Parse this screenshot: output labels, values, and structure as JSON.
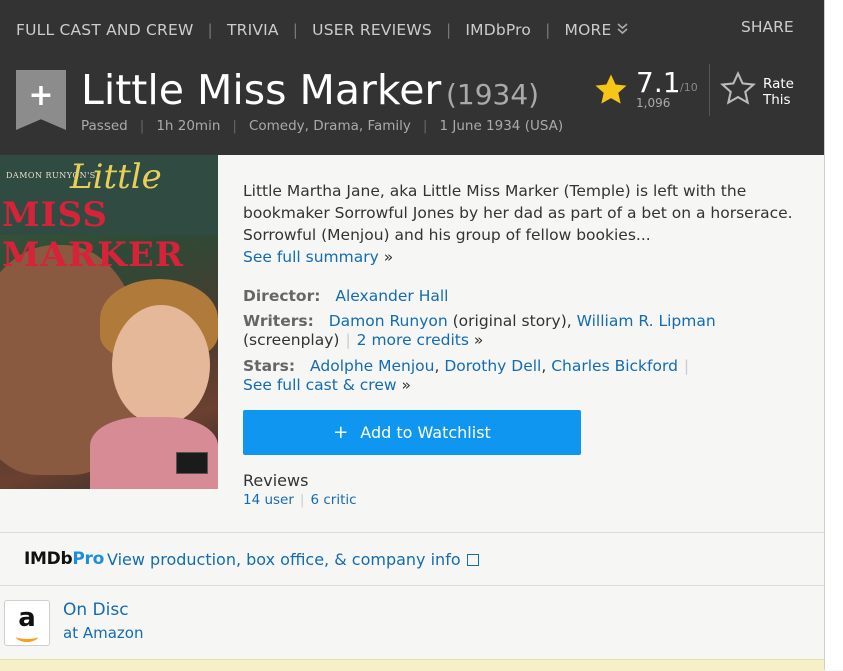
{
  "subnav": {
    "items": [
      "FULL CAST AND CREW",
      "TRIVIA",
      "USER REVIEWS",
      "IMDbPro",
      "MORE"
    ],
    "share": "SHARE"
  },
  "title": {
    "name": "Little Miss Marker",
    "year": "(1934)",
    "rating_cert": "Passed",
    "runtime": "1h 20min",
    "genres": "Comedy, Drama, Family",
    "release": "1 June 1934 (USA)"
  },
  "rating": {
    "value": "7.1",
    "max": "/10",
    "count": "1,096",
    "rate_label": "Rate This"
  },
  "poster": {
    "runyon": "DAMON RUNYON'S",
    "title_line1": "Little",
    "title_line2": "MISS MARKER"
  },
  "summary": {
    "text": "Little Martha Jane, aka Little Miss Marker (Temple) is left with the bookmaker Sorrowful Jones by her dad as part of a bet on a horserace. Sorrowful (Menjou) and his group of fellow bookies...",
    "more": "See full summary",
    "raquo": "»"
  },
  "credits": {
    "director_label": "Director:",
    "director": "Alexander Hall",
    "writers_label": "Writers:",
    "writer1": "Damon Runyon",
    "writer1_note": "(original story),",
    "writer2": "William R. Lipman",
    "writer2_note": "(screenplay)",
    "more_credits": "2 more credits",
    "stars_label": "Stars:",
    "star1": "Adolphe Menjou",
    "star2": "Dorothy Dell",
    "star3": "Charles Bickford",
    "full_cast": "See full cast & crew",
    "raquo": "»"
  },
  "watchlist": {
    "label": "Add to Watchlist"
  },
  "reviews": {
    "title": "Reviews",
    "user": "14 user",
    "critic": "6 critic"
  },
  "imdbpro": {
    "logo_a": "IMDb",
    "logo_b": "Pro",
    "link": "View production, box office, & company info"
  },
  "disc": {
    "title": "On Disc",
    "sub": "at Amazon",
    "logo_letter": "a"
  },
  "colors": {
    "header_bg": "#333333",
    "link": "#136cb2",
    "button": "#0f96f0",
    "star": "#f5c518"
  }
}
